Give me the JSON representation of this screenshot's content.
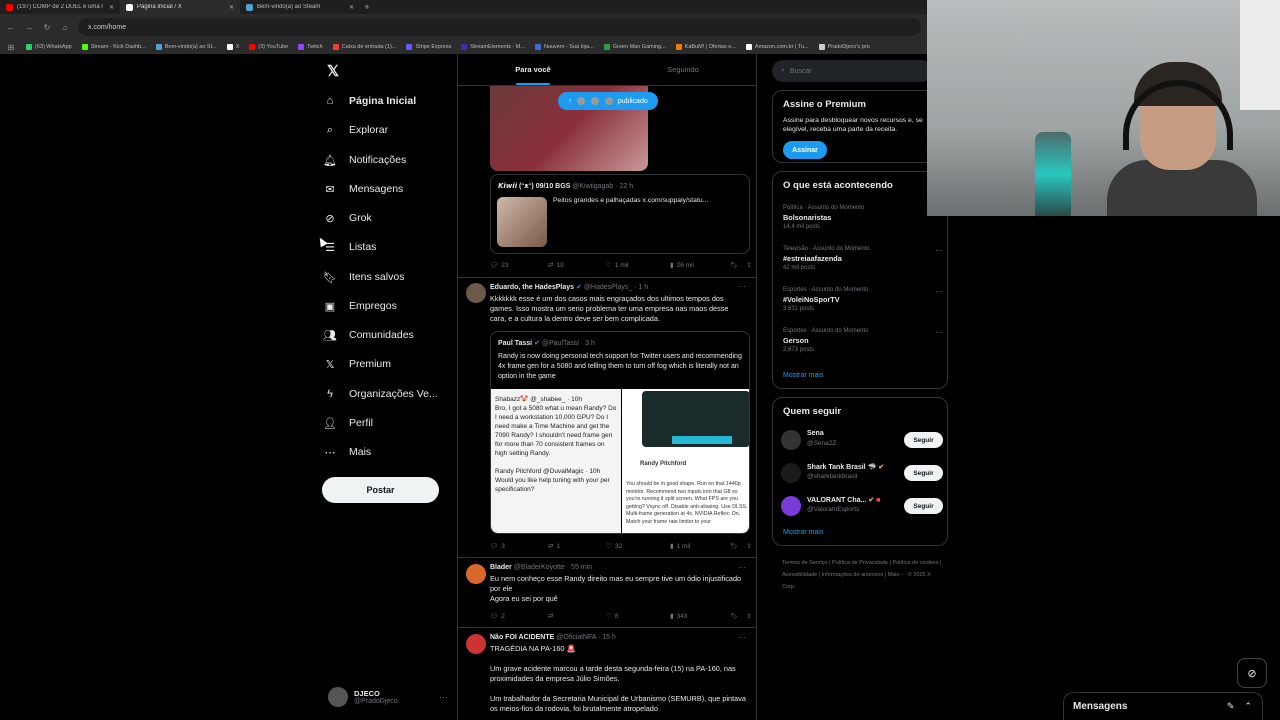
{
  "browser": {
    "tabs": [
      {
        "title": "(197) COMP de 2 DUEL é uma l",
        "color": "#ff0000"
      },
      {
        "title": "Página Inicial / X",
        "color": "#ffffff"
      },
      {
        "title": "Bem-vindo(a) ao Steam",
        "color": "#4fa3d1"
      }
    ],
    "url": "x.com/home",
    "bookmarks": [
      {
        "label": "(63) WhatsApp",
        "color": "#25d366"
      },
      {
        "label": "Stream - Kick Dashb...",
        "color": "#53fc18"
      },
      {
        "label": "Bem-vindo(a) ao St...",
        "color": "#4fa3d1"
      },
      {
        "label": "X",
        "color": "#ffffff"
      },
      {
        "label": "(3) YouTube",
        "color": "#ff0000"
      },
      {
        "label": "Twitch",
        "color": "#9146ff"
      },
      {
        "label": "Caixa de entrada (1)...",
        "color": "#ea4335"
      },
      {
        "label": "Stripe Express",
        "color": "#635bff"
      },
      {
        "label": "StreamElements - M...",
        "color": "#3c2fb5"
      },
      {
        "label": "Nuuvem - Sua loja...",
        "color": "#3a6fd8"
      },
      {
        "label": "Green Man Gaming...",
        "color": "#2e9e4a"
      },
      {
        "label": "KaBuM! | Ofertas e...",
        "color": "#f57c00"
      },
      {
        "label": "Amazon.com.br | Tu...",
        "color": "#ffffff"
      },
      {
        "label": "PradoDjeco's pro",
        "color": "#cccccc"
      }
    ]
  },
  "nav": {
    "items": [
      {
        "label": "Página Inicial",
        "icon": "⌂"
      },
      {
        "label": "Explorar",
        "icon": "⌕"
      },
      {
        "label": "Notificações",
        "icon": "🔔︎"
      },
      {
        "label": "Mensagens",
        "icon": "✉"
      },
      {
        "label": "Grok",
        "icon": "⊘"
      },
      {
        "label": "Listas",
        "icon": "☰"
      },
      {
        "label": "Itens salvos",
        "icon": "🔖︎"
      },
      {
        "label": "Empregos",
        "icon": "▣"
      },
      {
        "label": "Comunidades",
        "icon": "👥︎"
      },
      {
        "label": "Premium",
        "icon": "𝕏"
      },
      {
        "label": "Organizações Ve...",
        "icon": "ϟ"
      },
      {
        "label": "Perfil",
        "icon": "👤︎"
      },
      {
        "label": "Mais",
        "icon": "⋯"
      }
    ],
    "post_label": "Postar",
    "account_name": "DJECO",
    "account_handle": "@PradoDjeco"
  },
  "feed": {
    "tab_for_you": "Para você",
    "tab_following": "Seguindo",
    "pill": "publicado",
    "tweet1": {
      "quote_name": "𝙆𝙞𝙬𝙞𝙞 (ᵔᴥᵔ) 09/10 BGS",
      "quote_meta": "@Kiwiigagab · 22 h",
      "quote_text": "Peitos grandes e palhaçadas  x.com/suppaly/statu...",
      "replies": "23",
      "reposts": "19",
      "likes": "1 mil",
      "views": "26 mil"
    },
    "tweet2": {
      "name": "Eduardo, the HadesPlays",
      "meta": "@HadesPlays_ · 1 h",
      "text": "Kkkkkkk esse é um dos casos mais engraçados dos ultimos tempos dos games. Isso mostra um serio problema ter uma empresa nas maos desse cara, e a cultura la dentro deve ser bem complicada.",
      "quote_name": "Paul Tassi",
      "quote_meta": "@PaulTassi · 3 h",
      "quote_text": "Randy is now doing personal tech support for Twitter users and recommending 4x frame gen for a 5080 and telling them to turn off fog which is literally not an option in the game",
      "img_left_text": "Shabazz🤡 @_shabee_ · 10h\nBro, I got a 5080 what u mean Randy? Do I need a workstation 10,000 GPU? Do I need make a Time Machine and get the 7090 Randy? I shouldn't need frame gen for more than 70 consistent frames on high setting Randy.\n\nRandy Pitchford @DuvalMagic · 10h\nWould you like help tuning with your per specification?",
      "img_right_name": "Randy Pitchford",
      "img_right_text": "You should be in good shape. Run on that 1440p monitor. Recommend two inputs into that G8 so you're running it split screen. What FPS are you getting? Vsync off. Disable anti-aliasing. Use DLSS. Multi-frame generation at 4x. NVIDIA Reflex: On. Match your frame rate limiter to your",
      "replies": "3",
      "reposts": "1",
      "likes": "32",
      "views": "1 mil"
    },
    "tweet3": {
      "name": "Blader",
      "meta": "@BladerKoyotte · 55 min",
      "text": "Eu nem conheço esse Randy direito mas eu sempre tive um ódio injustificado por ele\nAgora eu sei por quê",
      "replies": "2",
      "reposts": "",
      "likes": "8",
      "views": "343"
    },
    "tweet4": {
      "name": "Não FOI ACIDENTE",
      "meta": "@OficialNFA · 15 h",
      "text1": "TRAGÉDIA NA PA-160 🚨",
      "text2": "Um grave acidente marcou a tarde desta segunda-feira (15) na PA-160, nas proximidades da empresa Júlio Simões.",
      "text3": "Um trabalhador da Secretaria Municipal de Urbanismo (SEMURB), que pintava os meios-fios da rodovia, foi brutalmente atropelado"
    }
  },
  "sidebar": {
    "search_placeholder": "Buscar",
    "premium_title": "Assine o Premium",
    "premium_text": "Assine para desbloquear novos recursos e, se elegível, receba uma parte da receita.",
    "premium_button": "Assinar",
    "trends_title": "O que está acontecendo",
    "trends": [
      {
        "cat": "Política · Assunto do Momento",
        "name": "Bolsonaristas",
        "count": "14,4 mil posts"
      },
      {
        "cat": "Televisão · Assunto do Momento",
        "name": "#estreiaafazenda",
        "count": "42 mil posts"
      },
      {
        "cat": "Esportes · Assunto do Momento",
        "name": "#VoleiNoSporTV",
        "count": "3.631 posts"
      },
      {
        "cat": "Esportes · Assunto do Momento",
        "name": "Gerson",
        "count": "2.673 posts"
      }
    ],
    "show_more": "Mostrar mais",
    "who_title": "Quem seguir",
    "who": [
      {
        "name": "Sena",
        "handle": "@Sena2Z",
        "button": "Seguir"
      },
      {
        "name": "Shark Tank Brasil 🦈",
        "handle": "@sharktankbrasil",
        "button": "Seguir"
      },
      {
        "name": "VALORANT Cha...",
        "handle": "@ValorantEsports",
        "button": "Seguir"
      }
    ],
    "footer": "Termos de Serviço  |  Política de Privacidade  |  Política de cookies  |  Acessibilidade  |  Informações de anúncios  |  Mais ···  © 2025 X Corp."
  },
  "messages_drawer": "Mensagens"
}
